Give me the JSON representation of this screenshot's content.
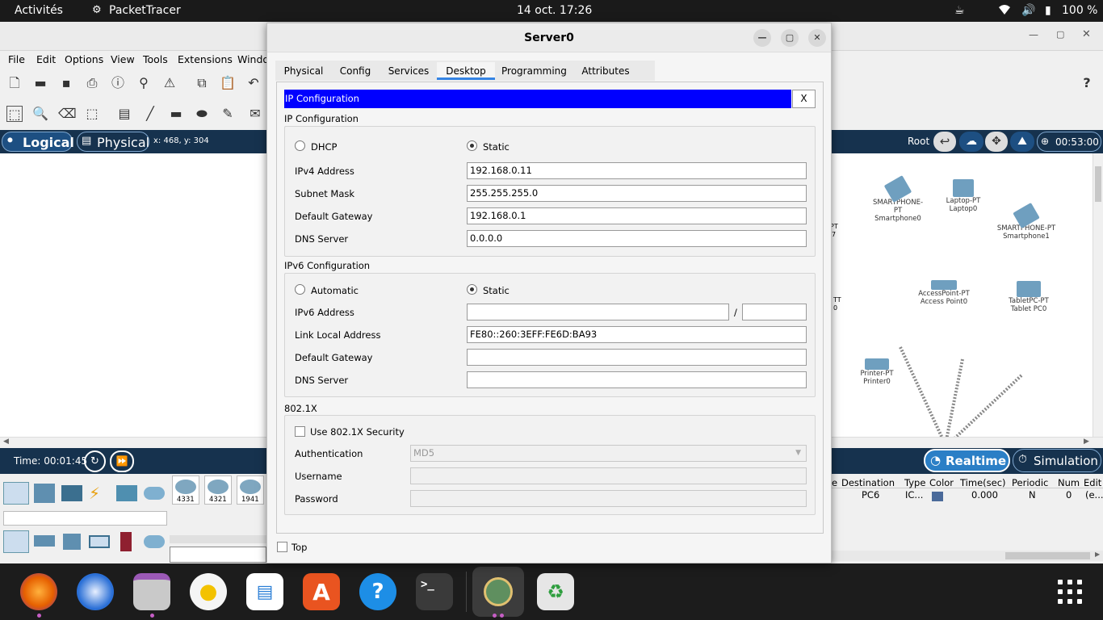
{
  "system_bar": {
    "activities": "Activités",
    "app_name": "PacketTracer",
    "clock": "14 oct.  17:26",
    "battery": "100 %"
  },
  "menubar": [
    "File",
    "Edit",
    "Options",
    "View",
    "Tools",
    "Extensions",
    "Windo"
  ],
  "viewbar": {
    "logical_label": "Logical",
    "physical_label": "Physical",
    "coords": "x: 468, y: 304",
    "root_label": "Root",
    "timer": "00:53:00"
  },
  "timebar": {
    "time": "Time: 00:01:45",
    "realtime_label": "Realtime",
    "simulation_label": "Simulation"
  },
  "device_models": [
    "4331",
    "4321",
    "1941"
  ],
  "pdu_table": {
    "headers": [
      "e",
      "Destination",
      "Type",
      "Color",
      "Time(sec)",
      "Periodic",
      "Num",
      "Edit"
    ],
    "row": {
      "destination": "PC6",
      "type": "IC...",
      "time": "0.000",
      "periodic": "N",
      "num": "0",
      "edit": "(e..."
    }
  },
  "topology": {
    "devices": [
      {
        "type": "SMARTPHONE-PT",
        "name": "Smartphone0"
      },
      {
        "type": "Laptop-PT",
        "name": "Laptop0"
      },
      {
        "type": "SMARTPHONE-PT",
        "name": "Smartphone1"
      },
      {
        "type": "AccessPoint-PT",
        "name": "Access Point0"
      },
      {
        "type": "TabletPC-PT",
        "name": "Tablet PC0"
      },
      {
        "type": "Printer-PT",
        "name": "Printer0"
      }
    ],
    "partial_labels": [
      "PT",
      "7",
      "TT",
      "0"
    ]
  },
  "dialog": {
    "title": "Server0",
    "tabs": [
      "Physical",
      "Config",
      "Services",
      "Desktop",
      "Programming",
      "Attributes"
    ],
    "active_tab": "Desktop",
    "app_title": "IP Configuration",
    "close_label": "X",
    "ipv4": {
      "section": "IP Configuration",
      "dhcp_label": "DHCP",
      "static_label": "Static",
      "mode": "Static",
      "ipv4_label": "IPv4 Address",
      "ipv4_value": "192.168.0.11",
      "mask_label": "Subnet Mask",
      "mask_value": "255.255.255.0",
      "gateway_label": "Default Gateway",
      "gateway_value": "192.168.0.1",
      "dns_label": "DNS Server",
      "dns_value": "0.0.0.0"
    },
    "ipv6": {
      "section": "IPv6 Configuration",
      "auto_label": "Automatic",
      "static_label": "Static",
      "mode": "Static",
      "ipv6_label": "IPv6 Address",
      "ipv6_value": "",
      "slash": "/",
      "prefix_value": "",
      "link_local_label": "Link Local Address",
      "link_local_value": "FE80::260:3EFF:FE6D:BA93",
      "gateway_label": "Default Gateway",
      "gateway_value": "",
      "dns_label": "DNS Server",
      "dns_value": ""
    },
    "dot1x": {
      "section": "802.1X",
      "use_label": "Use 802.1X Security",
      "use_checked": false,
      "auth_label": "Authentication",
      "auth_value": "MD5",
      "username_label": "Username",
      "username_value": "",
      "password_label": "Password",
      "password_value": ""
    },
    "top_label": "Top",
    "top_checked": false
  },
  "colors": {
    "app_title_bg": "#0000ff",
    "navy": "#16324e",
    "accent": "#3584e4",
    "pdu_color": "#4a6a9a"
  }
}
